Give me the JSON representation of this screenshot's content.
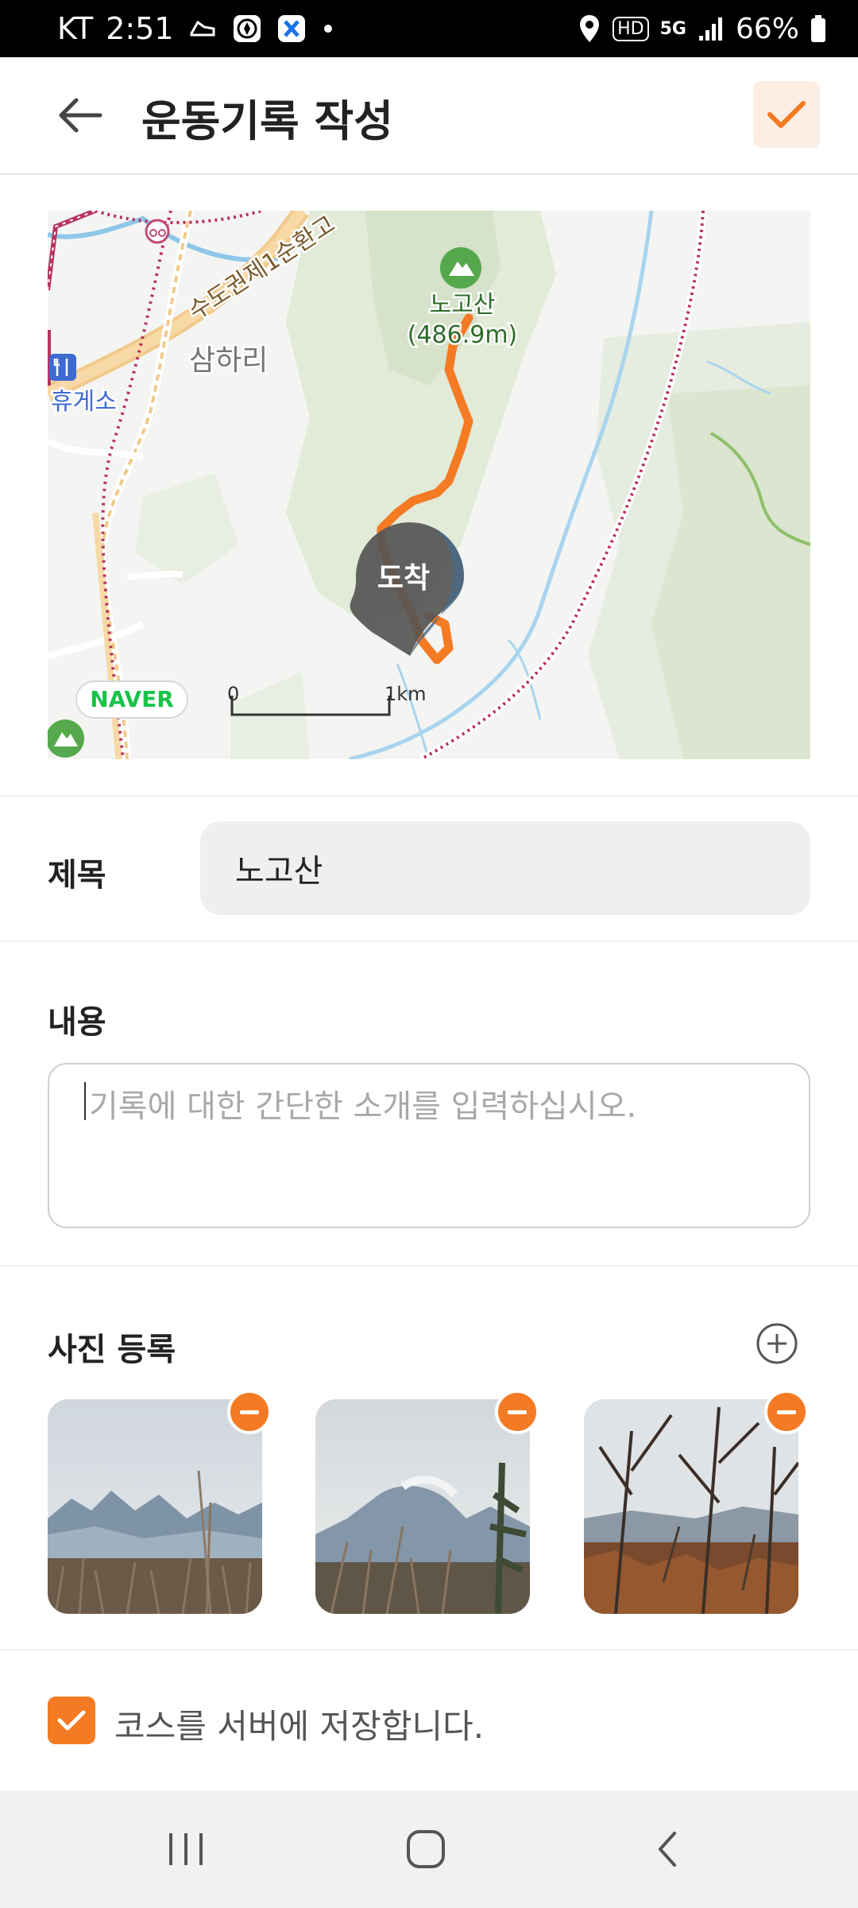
{
  "status_bar": {
    "carrier": "KT",
    "time": "2:51",
    "network": "5G",
    "hd": "HD",
    "battery": "66%"
  },
  "app_bar": {
    "title": "운동기록 작성"
  },
  "map": {
    "labels": {
      "mountain_name": "노고산",
      "mountain_height": "(486.9m)",
      "village": "삼하리",
      "rest_area": "휴게소",
      "highway": "수도권제1순환고",
      "marker": "도착",
      "scale_zero": "0",
      "scale_km": "1km",
      "provider": "NAVER"
    },
    "colors": {
      "route": "#f47a23",
      "forest": "#dfe8d5",
      "river": "#8ec7ea",
      "road": "#f1c98b",
      "marker": "#555555"
    }
  },
  "title_field": {
    "label": "제목",
    "value": "노고산"
  },
  "content_field": {
    "label": "내용",
    "placeholder": "기록에 대한 간단한 소개를 입력하십시오."
  },
  "photos": {
    "label": "사진 등록",
    "items": [
      "photo-1",
      "photo-2",
      "photo-3"
    ]
  },
  "save_course": {
    "label": "코스를 서버에 저장합니다.",
    "checked": true
  },
  "accent_color": "#f47a23"
}
